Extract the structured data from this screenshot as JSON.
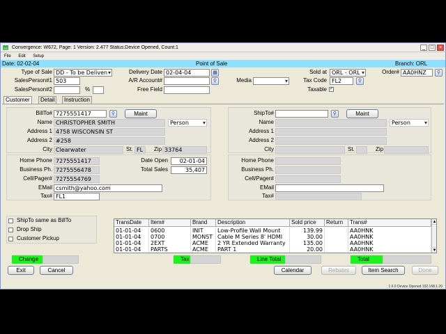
{
  "window": {
    "title": "Convergence: W672,  Page: 1  Version: 2.477  Status:Device Opened, Count:1",
    "menu": [
      "File",
      "Edit",
      "Setup"
    ],
    "buttons": {
      "minimize": "_",
      "maximize": "□",
      "close": "×"
    }
  },
  "header": {
    "date": "Date: 02-02-04",
    "title": "Point of Sale",
    "branch": "Branch: ORL"
  },
  "top": {
    "type_of_sale_label": "Type of Sale",
    "type_of_sale": "DD - To be Deliven",
    "salesperson1_label": "SalesPerson#1",
    "salesperson1": "503",
    "salesperson2_label": "SalesPerson#2",
    "salesperson2": "",
    "percent_label": "%",
    "percent": "",
    "delivery_date_label": "Delivery Date",
    "delivery_date": "02-04-04",
    "ar_account_label": "A/R Account#",
    "ar_account": "",
    "free_field_label": "Free Field",
    "free_field": "",
    "media_label": "Media",
    "media": "",
    "sold_at_label": "Sold at",
    "sold_at": "ORL  - ORL",
    "order_label": "Order#",
    "order": "AA0HNZ",
    "tax_code_label": "Tax Code",
    "tax_code": "FL2",
    "taxable_label": "Taxable",
    "taxable_mark": "✓"
  },
  "tabs": [
    "Customer",
    "Detail",
    "Instruction"
  ],
  "billto": {
    "billto_label": "BillTo#",
    "billto": "7275551417",
    "maint": "Maint",
    "name_label": "Name",
    "name": "CHRISTOPHER SMITH",
    "type": "Person",
    "addr1_label": "Address 1",
    "addr1": "4758 WISCONSIN ST",
    "addr2_label": "Address 2",
    "addr2": "#258",
    "city_label": "City",
    "city": "Clearwater",
    "st_label": "St.",
    "st": "FL",
    "zip_label": "Zip",
    "zip": "33764",
    "home_phone_label": "Home Phone",
    "home_phone": "7275551417",
    "business_label": "Business Ph.",
    "business": "7275556478",
    "cell_label": "Cell/Pager#",
    "cell": "7275554769",
    "email_label": "EMail",
    "email": "csmith@yahoo.com",
    "tax_label": "Tax#",
    "tax": "FL1",
    "date_open_label": "Date Open",
    "date_open": "02-01-04",
    "total_sales_label": "Total Sales",
    "total_sales": "35,407"
  },
  "shipto": {
    "shipto_label": "ShipTo#",
    "shipto": "",
    "maint": "Maint",
    "name_label": "Name",
    "type": "Person",
    "addr1_label": "Address 1",
    "addr2_label": "Address 2",
    "city_label": "City",
    "st_label": "St.",
    "zip_label": "Zip",
    "home_phone_label": "Home Phone",
    "business_label": "Business Ph.",
    "cell_label": "Cell/Pager#",
    "email_label": "EMail",
    "tax_label": "Tax#"
  },
  "options": [
    "ShipTo same as BillTo",
    "Drop Ship",
    "Customer Pickup"
  ],
  "grid": {
    "columns": [
      "TransDate",
      "Item#",
      "Brand",
      "Description",
      "Sold price",
      "Return",
      "Trans#"
    ],
    "rows": [
      [
        "01-01-04",
        "0600",
        "INIT",
        "Low-Profile Wall Mount",
        "139.99",
        "",
        "AA0HNK"
      ],
      [
        "01-01-04",
        "0700",
        "MONST",
        "Cable M Series 8' HDMI",
        "30.00",
        "",
        "AA0HNK"
      ],
      [
        "01-01-04",
        "2EXT",
        "ACME",
        "2 YR Extended Warranty",
        "135.00",
        "",
        "AA0HNK"
      ],
      [
        "01-01-04",
        "PARTS",
        "ACME",
        "PART 1",
        "20.00",
        "",
        "AA0HNK"
      ]
    ]
  },
  "totals": {
    "change": "Change",
    "tax": "Tax",
    "line_total": "Line Total",
    "total": "Total"
  },
  "footer": {
    "exit": "Exit",
    "cancel": "Cancel",
    "calendar": "Calendar",
    "rebates": "Rebates",
    "item_search": "Item Search",
    "done": "Done",
    "status": "1  6.0  Device Opened  192.168.1.20"
  }
}
